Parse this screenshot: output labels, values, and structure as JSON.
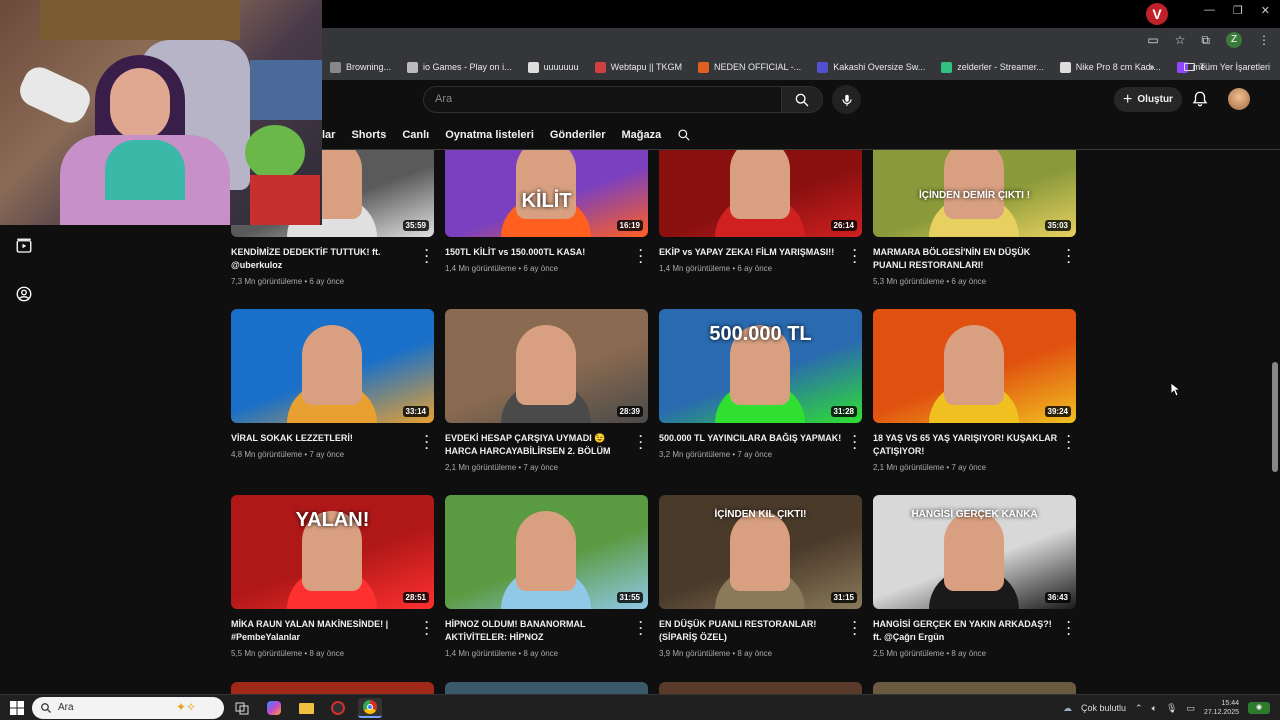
{
  "browser": {
    "bookmarks": [
      {
        "label": "Browning...",
        "icon": "generic",
        "color": "#888888"
      },
      {
        "label": "io Games - Play on i...",
        "icon": "game-icon",
        "color": "#bbbbbb"
      },
      {
        "label": "uuuuuuu",
        "icon": "github-icon",
        "color": "#dddddd"
      },
      {
        "label": "Webtapu || TKGM",
        "icon": "flag-icon",
        "color": "#d04040"
      },
      {
        "label": "NEDEN OFFICIAL -...",
        "icon": "circle-icon",
        "color": "#e06020"
      },
      {
        "label": "Kakashi Oversize Sw...",
        "icon": "s-icon",
        "color": "#5050d0"
      },
      {
        "label": "zelderler - Streamer...",
        "icon": "tt-icon",
        "color": "#30c080"
      },
      {
        "label": "Nike Pro 8 cm Kadı...",
        "icon": "nike-icon",
        "color": "#dddddd"
      },
      {
        "label": "me",
        "icon": "twitch-icon",
        "color": "#9146ff"
      }
    ],
    "all_bookmarks": "Tüm Yer İşaretleri",
    "profile_letter": "Z"
  },
  "header": {
    "search_placeholder": "Ara",
    "create_label": "Oluştur"
  },
  "tabs": [
    {
      "label": "lar",
      "active": true
    },
    {
      "label": "Shorts"
    },
    {
      "label": "Canlı"
    },
    {
      "label": "Oynatma listeleri"
    },
    {
      "label": "Gönderiler"
    },
    {
      "label": "Mağaza"
    }
  ],
  "videos": [
    {
      "title": "KENDİMİZE DEDEKTİF TUTTUK! ft. @uberkuloz",
      "views": "7,3 Mn görüntüleme",
      "age": "6 ay önce",
      "duration": "35:59",
      "bg": "#5a5a5a",
      "accent": "#e0e0e0",
      "caption": ""
    },
    {
      "title": "150TL KİLİT vs 150.000TL KASA!",
      "views": "1,4 Mn görüntüleme",
      "age": "6 ay önce",
      "duration": "16:19",
      "bg": "#7a40c0",
      "accent": "#ff6020",
      "caption": "KİLİT"
    },
    {
      "title": "EKİP vs YAPAY ZEKA! FİLM YARIŞMASI!!",
      "views": "1,4 Mn görüntüleme",
      "age": "6 ay önce",
      "duration": "26:14",
      "bg": "#8a1010",
      "accent": "#d02020",
      "caption": ""
    },
    {
      "title": "MARMARA BÖLGESİ'NİN EN DÜŞÜK PUANLI RESTORANLARI!",
      "views": "5,3 Mn görüntüleme",
      "age": "6 ay önce",
      "duration": "35:03",
      "bg": "#8a9a3a",
      "accent": "#e8d060",
      "caption": "İÇİNDEN DEMİR ÇIKTI !"
    },
    {
      "title": "VİRAL SOKAK LEZZETLERİ!",
      "views": "4,8 Mn görüntüleme",
      "age": "7 ay önce",
      "duration": "33:14",
      "bg": "#1a70c8",
      "accent": "#e8a030",
      "caption": ""
    },
    {
      "title": "EVDEKİ HESAP ÇARŞIYA UYMADI 😉 HARCA HARCAYABİLİRSEN 2. BÖLÜM",
      "views": "2,1 Mn görüntüleme",
      "age": "7 ay önce",
      "duration": "28:39",
      "bg": "#8a6a50",
      "accent": "#4a4a4a",
      "caption": ""
    },
    {
      "title": "500.000 TL YAYINCILARA BAĞIŞ YAPMAK!",
      "views": "3,2 Mn görüntüleme",
      "age": "7 ay önce",
      "duration": "31:28",
      "bg": "#2a6ab0",
      "accent": "#30e030",
      "caption": "500.000 TL"
    },
    {
      "title": "18 YAŞ VS 65 YAŞ YARIŞIYOR! KUŞAKLAR ÇATIŞIYOR!",
      "views": "2,1 Mn görüntüleme",
      "age": "7 ay önce",
      "duration": "39:24",
      "bg": "#e05010",
      "accent": "#f0c020",
      "caption": ""
    },
    {
      "title": "MİKA RAUN YALAN MAKİNESİNDE! | #PembeYalanlar",
      "views": "5,5 Mn görüntüleme",
      "age": "8 ay önce",
      "duration": "28:51",
      "bg": "#b01818",
      "accent": "#ff3030",
      "caption": "YALAN!"
    },
    {
      "title": "HİPNOZ OLDUM! BANANORMAL AKTİVİTELER: HİPNOZ",
      "views": "1,4 Mn görüntüleme",
      "age": "8 ay önce",
      "duration": "31:55",
      "bg": "#5a9a40",
      "accent": "#90c8e8",
      "caption": ""
    },
    {
      "title": "EN DÜŞÜK PUANLI RESTORANLAR! (SİPARİŞ ÖZEL)",
      "views": "3,9 Mn görüntüleme",
      "age": "8 ay önce",
      "duration": "31:15",
      "bg": "#4a3a2a",
      "accent": "#8a7a5a",
      "caption": "İÇİNDEN KIL ÇIKTI!"
    },
    {
      "title": "HANGİSİ GERÇEK EN YAKIN ARKADAŞ?! ft. @Çağrı Ergün",
      "views": "2,5 Mn görüntüleme",
      "age": "8 ay önce",
      "duration": "36:43",
      "bg": "#d8d8d8",
      "accent": "#1a1a1a",
      "caption": "HANGİSİ GERÇEK KANKA"
    }
  ],
  "taskbar": {
    "search_placeholder": "Ara",
    "weather": "Çok bulutlu",
    "time": "15:44",
    "date": "27.12.2025"
  }
}
